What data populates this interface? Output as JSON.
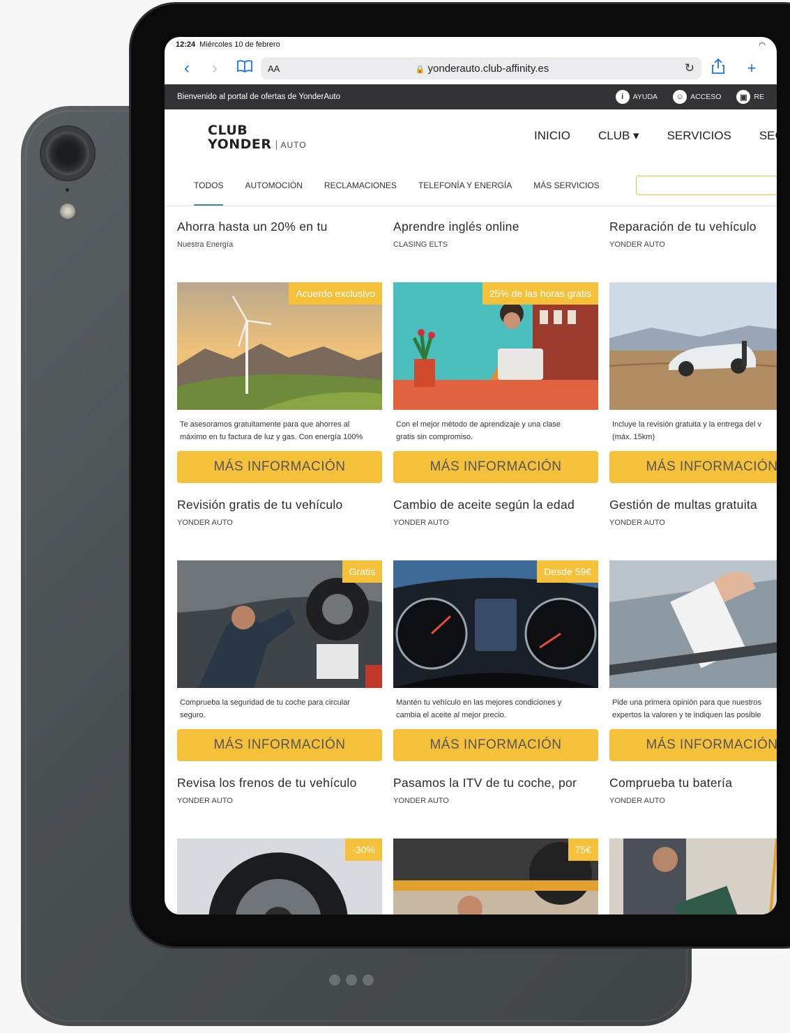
{
  "status": {
    "time": "12:24",
    "date": "Miércoles 10 de febrero",
    "wifi": "wifi-icon"
  },
  "browser": {
    "text_size": "AA",
    "url": "yonderauto.club-affinity.es"
  },
  "topbar": {
    "welcome": "Bienvenido al portal de ofertas de YonderAuto",
    "links": [
      "AYUDA",
      "ACCESO",
      "RE"
    ]
  },
  "header": {
    "logo_line1": "CLUB",
    "logo_line2": "YONDER",
    "logo_sub": "AUTO",
    "nav": [
      "INICIO",
      "CLUB ▾",
      "SERVICIOS",
      "SEGU"
    ]
  },
  "categories": [
    "TODOS",
    "AUTOMOCIÓN",
    "RECLAMACIONES",
    "TELEFONÍA Y ENERGÍA",
    "MÁS SERVICIOS"
  ],
  "cards": [
    {
      "title": "Ahorra hasta un 20% en tu",
      "source": "Nuestra Energía",
      "badge": "Acuerdo exclusivo",
      "desc1": "Te asesoramos gratuitamente para que ahorres al",
      "desc2": "máximo en tu factura de luz y gas. Con energía 100%",
      "cta": "MÁS INFORMACIÓN"
    },
    {
      "title": "Aprendre inglés online",
      "source": "CLASING ELTS",
      "badge": "25% de las horas gratis",
      "desc1": "Con el mejor método de aprendizaje y una clase",
      "desc2": "gratis sin compromiso.",
      "cta": "MÁS INFORMACIÓN"
    },
    {
      "title": "Reparación de tu vehículo",
      "source": "YONDER AUTO",
      "badge": "",
      "desc1": "Incluye la revisión gratuita y la entrega del v",
      "desc2": "(máx. 15km)",
      "cta": "MÁS INFORMACIÓN"
    },
    {
      "title": "Revisión gratis de tu vehículo",
      "source": "YONDER AUTO",
      "badge": "Gratis",
      "desc1": "Comprueba la seguridad de tu coche para circular",
      "desc2": "seguro.",
      "cta": "MÁS INFORMACIÓN"
    },
    {
      "title": "Cambio de aceite según la edad",
      "source": "YONDER AUTO",
      "badge": "Desde 59€",
      "desc1": "Mantén tu vehículo en las mejores condiciones y",
      "desc2": "cambia el aceite al mejor precio.",
      "cta": "MÁS INFORMACIÓN"
    },
    {
      "title": "Gestión de multas gratuita",
      "source": "YONDER AUTO",
      "badge": "",
      "desc1": "Pide una primera opinión para que nuestros",
      "desc2": "expertos la valoren y te indiquen las posible",
      "cta": "MÁS INFORMACIÓN"
    },
    {
      "title": "Revisa los frenos de tu vehículo",
      "source": "YONDER AUTO",
      "badge": "-30%",
      "desc1": "",
      "desc2": "",
      "cta": ""
    },
    {
      "title": "Pasamos la ITV de tu coche, por",
      "source": "YONDER AUTO",
      "badge": "75€",
      "desc1": "",
      "desc2": "",
      "cta": ""
    },
    {
      "title": "Comprueba tu batería",
      "source": "YONDER AUTO",
      "badge": "",
      "desc1": "",
      "desc2": "",
      "cta": ""
    }
  ],
  "colors": {
    "accent": "#f5c13a",
    "topbar": "#333335",
    "tab_underline": "#3c8a8c"
  }
}
